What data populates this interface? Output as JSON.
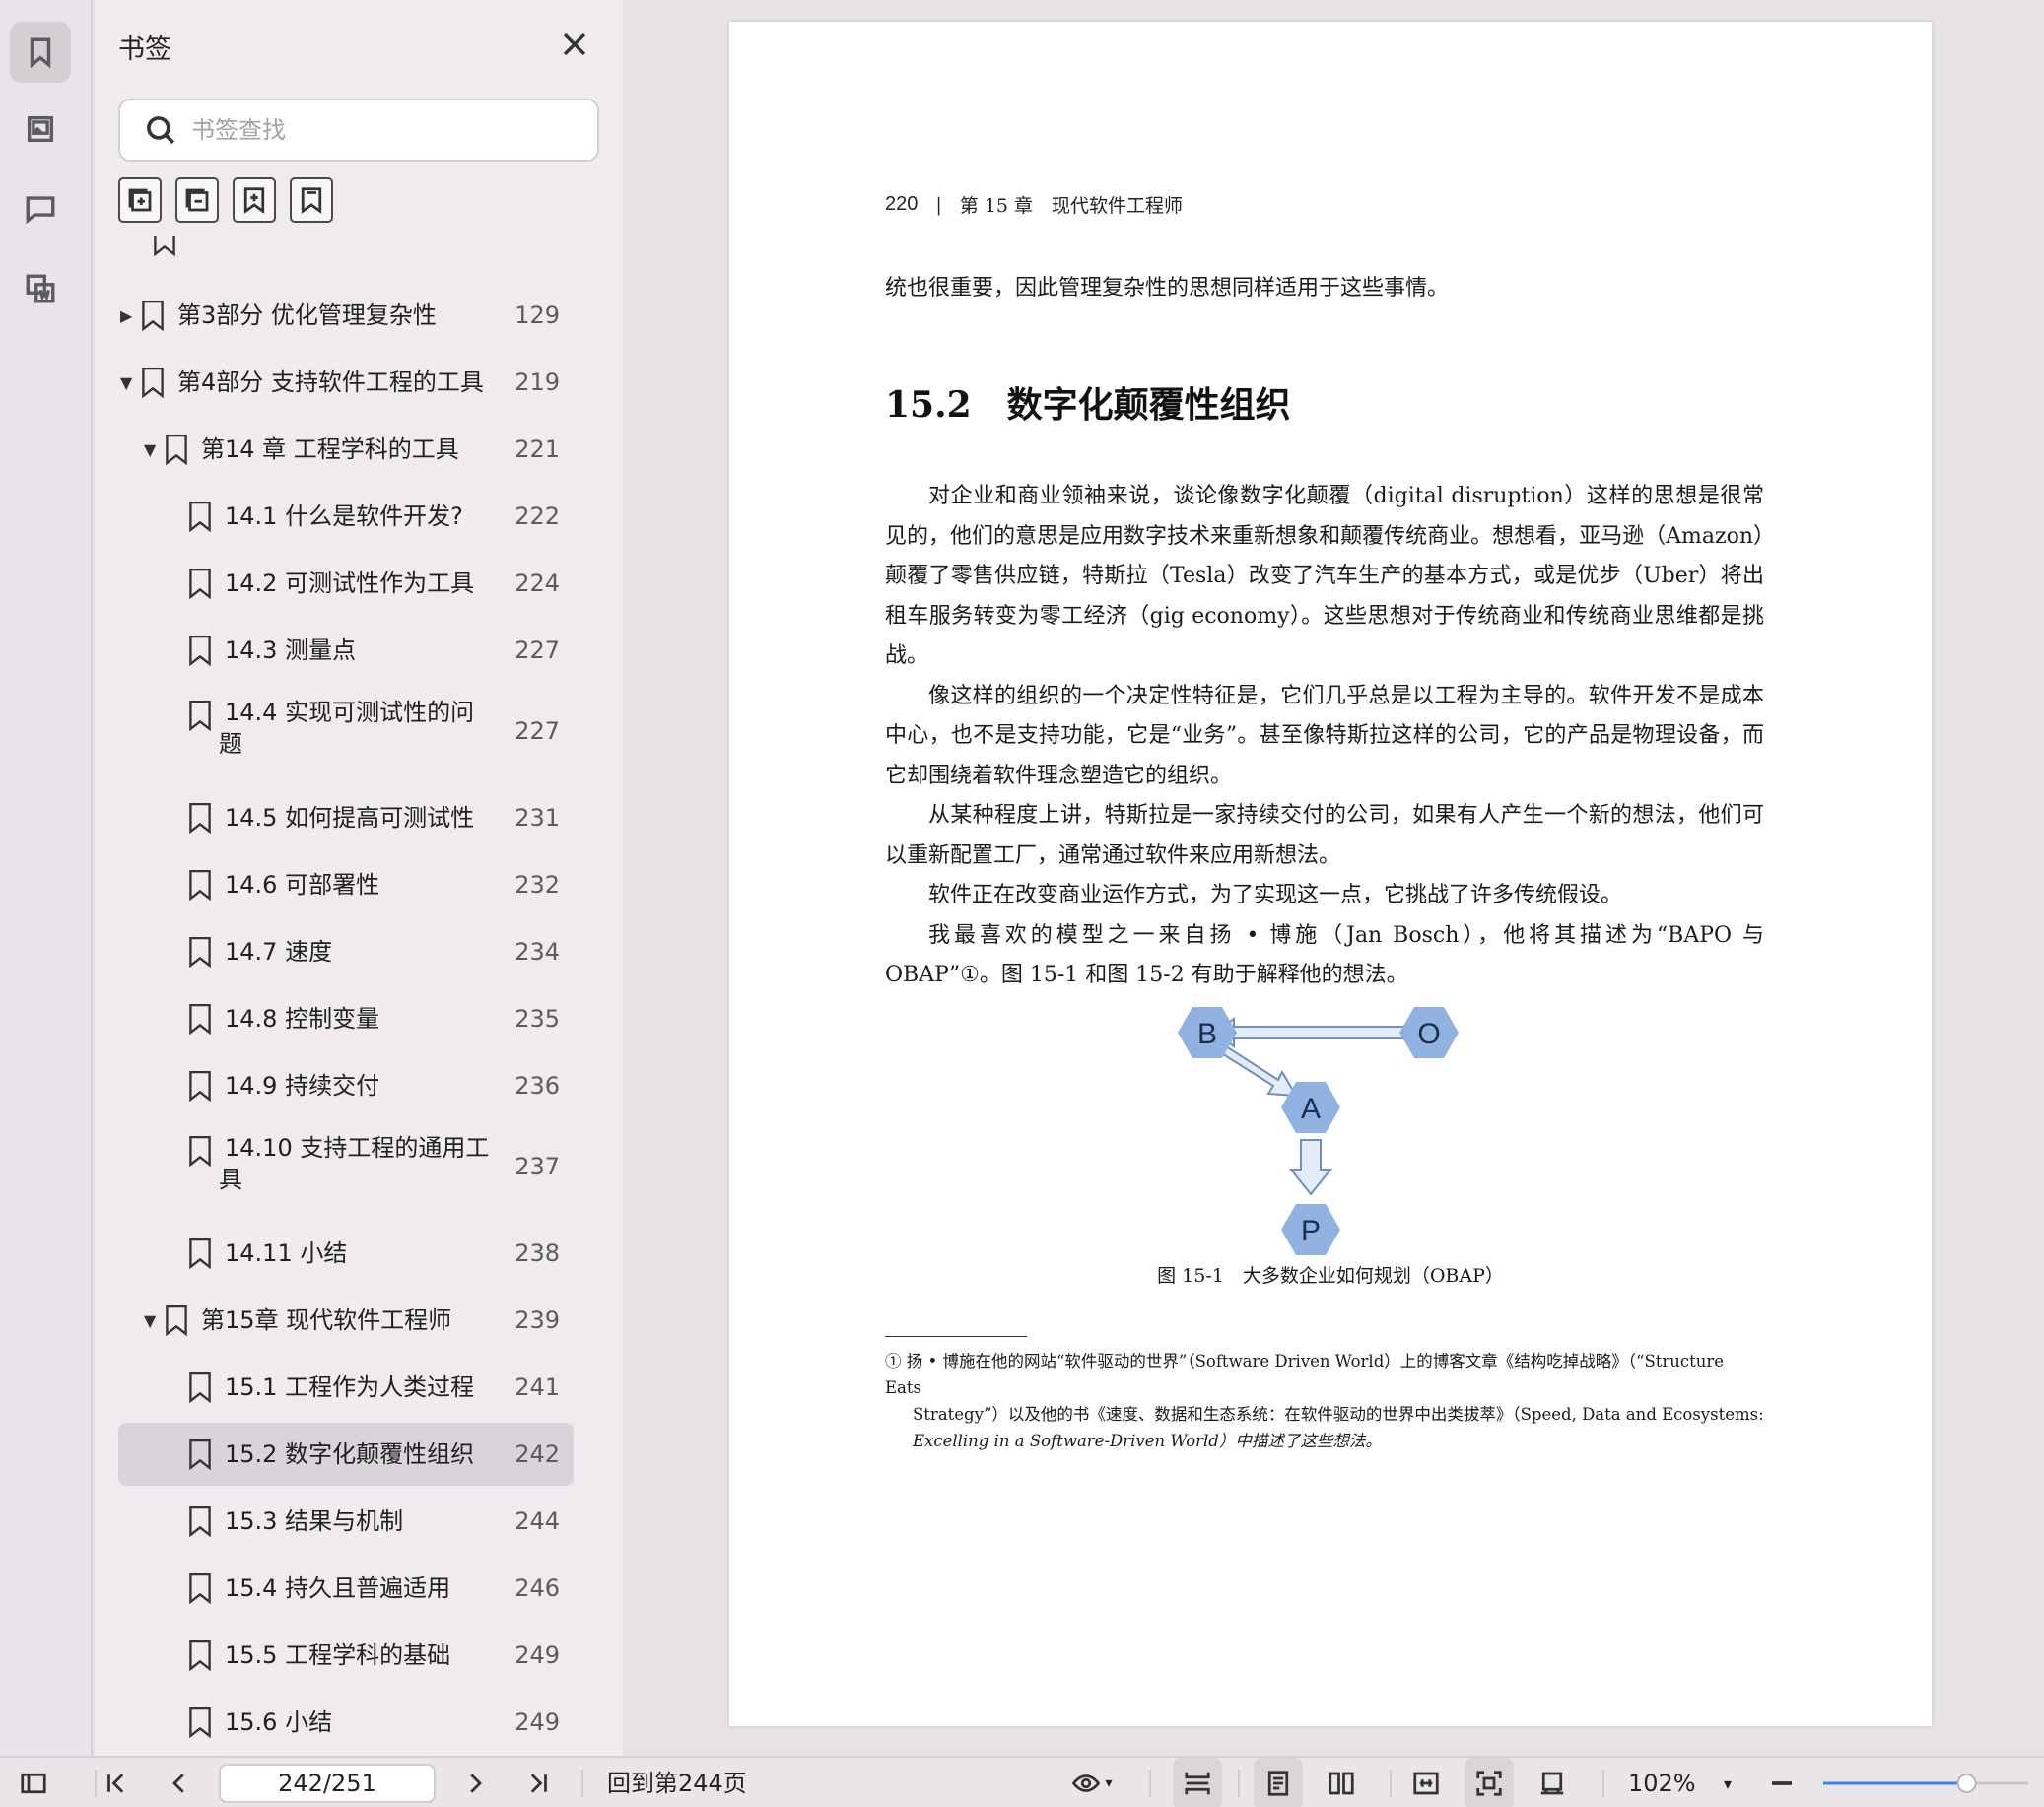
{
  "sidebar": {
    "title": "书签",
    "search_placeholder": "书签查找",
    "items": [
      {
        "label": "第3部分 优化管理复杂性",
        "page": "129"
      },
      {
        "label": "第4部分 支持软件工程的工具",
        "page": "219"
      },
      {
        "label": "第14 章 工程学科的工具",
        "page": "221"
      },
      {
        "label": "14.1 什么是软件开发?",
        "page": "222"
      },
      {
        "label": "14.2 可测试性作为工具",
        "page": "224"
      },
      {
        "label": "14.3 测量点",
        "page": "227"
      },
      {
        "label": "14.4 实现可测试性的问",
        "label2": "题",
        "page": "227"
      },
      {
        "label": "14.5 如何提高可测试性",
        "page": "231"
      },
      {
        "label": "14.6 可部署性",
        "page": "232"
      },
      {
        "label": "14.7 速度",
        "page": "234"
      },
      {
        "label": "14.8 控制变量",
        "page": "235"
      },
      {
        "label": "14.9 持续交付",
        "page": "236"
      },
      {
        "label": "14.10 支持工程的通用工",
        "label2": "具",
        "page": "237"
      },
      {
        "label": "14.11 小结",
        "page": "238"
      },
      {
        "label": "第15章 现代软件工程师",
        "page": "239"
      },
      {
        "label": "15.1 工程作为人类过程",
        "page": "241"
      },
      {
        "label": "15.2 数字化颠覆性组织",
        "page": "242"
      },
      {
        "label": "15.3 结果与机制",
        "page": "244"
      },
      {
        "label": "15.4 持久且普遍适用",
        "page": "246"
      },
      {
        "label": "15.5 工程学科的基础",
        "page": "249"
      },
      {
        "label": "15.6 小结",
        "page": "249"
      }
    ]
  },
  "document": {
    "header_page": "220",
    "header_sep": "|",
    "header_chapter": "第 15 章　现代软件工程师",
    "line_top": "统也很重要，因此管理复杂性的思想同样适用于这些事情。",
    "section_title": "15.2　数字化颠覆性组织",
    "paragraphs": [
      "对企业和商业领袖来说，谈论像数字化颠覆（digital disruption）这样的思想是很常见的，他们的意思是应用数字技术来重新想象和颠覆传统商业。想想看，亚马逊（Amazon）颠覆了零售供应链，特斯拉（Tesla）改变了汽车生产的基本方式，或是优步（Uber）将出租车服务转变为零工经济（gig economy）。这些思想对于传统商业和传统商业思维都是挑战。",
      "像这样的组织的一个决定性特征是，它们几乎总是以工程为主导的。软件开发不是成本中心，也不是支持功能，它是“业务”。甚至像特斯拉这样的公司，它的产品是物理设备，而它却围绕着软件理念塑造它的组织。",
      "从某种程度上讲，特斯拉是一家持续交付的公司，如果有人产生一个新的想法，他们可以重新配置工厂，通常通过软件来应用新想法。",
      "软件正在改变商业运作方式，为了实现这一点，它挑战了许多传统假设。",
      "我最喜欢的模型之一来自扬 • 博施（Jan Bosch），他将其描述为“BAPO 与 OBAP”①。图 15-1 和图 15-2 有助于解释他的想法。"
    ],
    "figure_nodes": {
      "b": "B",
      "o": "O",
      "a": "A",
      "p": "P"
    },
    "figure_caption": "图 15-1　大多数企业如何规划（OBAP）",
    "footnote_1": "① 扬 • 博施在他的网站“软件驱动的世界”（Software Driven World）上的博客文章《结构吃掉战略》（“Structure Eats",
    "footnote_2": "Strategy”）以及他的书《速度、数据和生态系统：在软件驱动的世界中出类拔萃》（Speed, Data and Ecosystems:",
    "footnote_3": "Excelling in a Software-Driven World）中描述了这些想法。"
  },
  "toolbar": {
    "page_field": "242/251",
    "goto_label": "回到第244页",
    "zoom": "102%",
    "zoom_slider_fraction": 0.7
  },
  "colors": {
    "hex_fill": "#8fb2e0",
    "arrow_fill": "#e4ecf7",
    "arrow_stroke": "#6e8fbf",
    "accent": "#3b82f6"
  }
}
